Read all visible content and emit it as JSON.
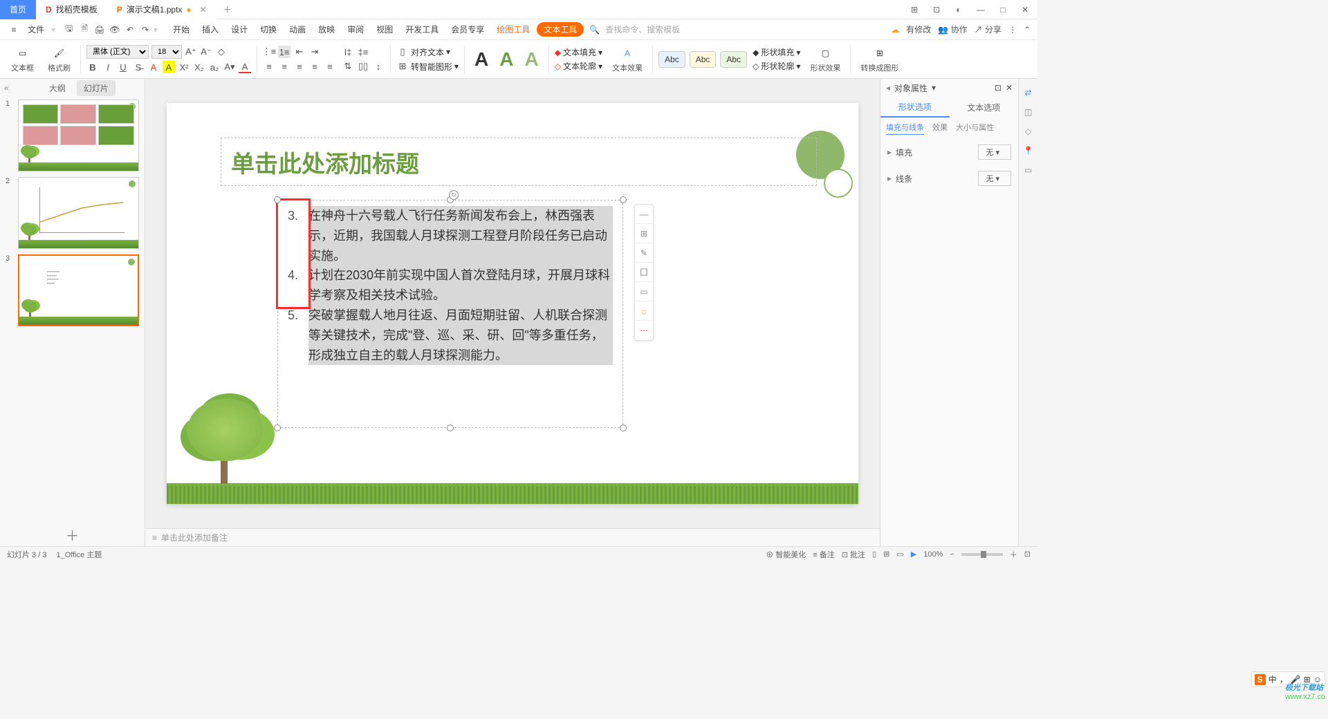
{
  "titlebar": {
    "home_tab": "首页",
    "template_tab": "找稻壳模板",
    "doc_tab": "演示文稿1.pptx",
    "win_icons": [
      "⊞",
      "⊟",
      "◧",
      "—",
      "□",
      "✕"
    ]
  },
  "menubar": {
    "file": "文件",
    "items": [
      "开始",
      "插入",
      "设计",
      "切换",
      "动画",
      "放映",
      "审阅",
      "视图",
      "开发工具",
      "会员专享"
    ],
    "draw_tool": "绘图工具",
    "text_tool": "文本工具",
    "search_placeholder": "查找命令、搜索模板",
    "right": {
      "pending": "有修改",
      "collab": "协作",
      "share": "分享"
    }
  },
  "ribbon": {
    "textbox": "文本框",
    "format_painter": "格式刷",
    "font_name": "黑体 (正文)",
    "font_size": "18",
    "align_text": "对齐文本",
    "smart_graphic": "转智能图形",
    "text_fill": "文本填充",
    "text_outline": "文本轮廓",
    "text_effect": "文本效果",
    "shape_fill": "形状填充",
    "shape_outline": "形状轮廓",
    "shape_effect": "形状效果",
    "convert_graphic": "转换成图形",
    "abc": "Abc"
  },
  "slide_panel": {
    "collapse": "«",
    "outline_tab": "大纲",
    "slides_tab": "幻灯片",
    "add": "＋"
  },
  "slide": {
    "title": "单击此处添加标题",
    "items": [
      "在神舟十六号载人飞行任务新闻发布会上，林西强表示，近期，我国载人月球探测工程登月阶段任务已启动实施。",
      "计划在2030年前实现中国人首次登陆月球，开展月球科学考察及相关技术试验。",
      "突破掌握载人地月往返、月面短期驻留、人机联合探测等关键技术，完成\"登、巡、采、研、回\"等多重任务，形成独立自主的载人月球探测能力。"
    ],
    "float_tools": [
      "—",
      "⊞",
      "✎",
      "囗",
      "▭",
      "☼",
      "⋯"
    ]
  },
  "notes": {
    "placeholder": "单击此处添加备注"
  },
  "right_panel": {
    "title": "对象属性",
    "tab_shape": "形状选项",
    "tab_text": "文本选项",
    "sub_fill": "填充与线条",
    "sub_effect": "效果",
    "sub_size": "大小与属性",
    "fill": "填充",
    "line": "线条",
    "none": "无"
  },
  "statusbar": {
    "slide_info": "幻灯片 3 / 3",
    "theme": "1_Office 主题",
    "beautify": "智能美化",
    "notes": "备注",
    "bulk": "批注",
    "zoom": "100%"
  },
  "watermark": {
    "brand": "极光下载站",
    "url": "www.xz7.co"
  },
  "ime": {
    "lang": "中",
    "dot": "，",
    "mic": "🎤",
    "grid": "⊞",
    "face": "☺"
  }
}
